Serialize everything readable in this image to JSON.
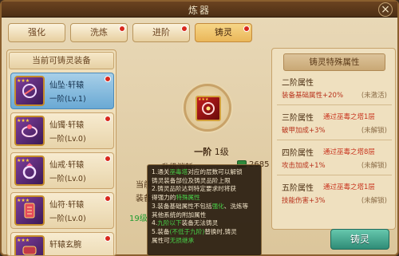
{
  "window": {
    "title": "炼器"
  },
  "tabs": [
    {
      "label": "强化",
      "dot": false
    },
    {
      "label": "洗炼",
      "dot": true
    },
    {
      "label": "进阶",
      "dot": true
    },
    {
      "label": "铸灵",
      "dot": true,
      "active": true
    }
  ],
  "left_panel": {
    "header": "当前可铸灵装备",
    "items": [
      {
        "name": "仙坠·轩辕",
        "level": "一阶(Lv.1)",
        "selected": true,
        "dot": true
      },
      {
        "name": "仙镯·轩辕",
        "level": "一阶(Lv.0)",
        "selected": false,
        "dot": true
      },
      {
        "name": "仙戒·轩辕",
        "level": "一阶(Lv.0)",
        "selected": false,
        "dot": true
      },
      {
        "name": "仙符·轩辕",
        "level": "一阶(Lv.0)",
        "selected": false,
        "dot": true
      },
      {
        "name": "轩辕玄腕",
        "level": "",
        "selected": false,
        "dot": true
      }
    ]
  },
  "center": {
    "stage": "一阶",
    "level": "1级",
    "cost_label": "升级消耗:",
    "cost_value": "2685",
    "partial_left_1": "当前",
    "partial_left_2": "装备",
    "partial_level": "19级"
  },
  "tooltip": {
    "lines": [
      {
        "pre": "1.通关",
        "hl": "巫毒塔",
        "post": "对应的层数可以解锁"
      },
      {
        "pre": "铸灵装备部位及铸灵品阶上限",
        "hl": "",
        "post": ""
      },
      {
        "pre": "2.铸灵品阶达到特定要求时将获",
        "hl": "",
        "post": ""
      },
      {
        "pre": "得强力的",
        "hl": "特殊属性",
        "post": ""
      },
      {
        "pre": "3.装备基础属性不包括",
        "hl": "强化",
        "post": "、洗炼等"
      },
      {
        "pre": "其他系统的附加属性",
        "hl": "",
        "post": ""
      },
      {
        "pre": "4.",
        "hl": "九阶以下",
        "post": "装备无法铸灵"
      },
      {
        "pre": "5.装备",
        "hl": "(不低于九阶)",
        "post": "替换时,铸灵"
      },
      {
        "pre": "属性可",
        "hl": "无损继承",
        "post": ""
      }
    ]
  },
  "right_panel": {
    "header": "铸灵特殊属性",
    "tiers": [
      {
        "title": "二阶属性",
        "condition": "",
        "value": "装备基础属性+20%",
        "status": "(未激活)"
      },
      {
        "title": "三阶属性",
        "condition": "通过巫毒之塔1层",
        "value": "破甲加成+3%",
        "status": "(未解锁)"
      },
      {
        "title": "四阶属性",
        "condition": "通过巫毒之塔8层",
        "value": "攻击加成+1%",
        "status": "(未解锁)"
      },
      {
        "title": "五阶属性",
        "condition": "通过巫毒之塔1层",
        "value": "技能伤害+3%",
        "status": "(未解锁)"
      }
    ]
  },
  "cast_button": {
    "label": "铸灵"
  },
  "colors": {
    "accent": "#2f8c77",
    "selected": "#6aa9d4",
    "red": "#c8321c",
    "green": "#1f9b2e"
  },
  "icons": {
    "close": "close-icon",
    "coin": "jade-coin-icon",
    "equip": "pendant-icon"
  }
}
